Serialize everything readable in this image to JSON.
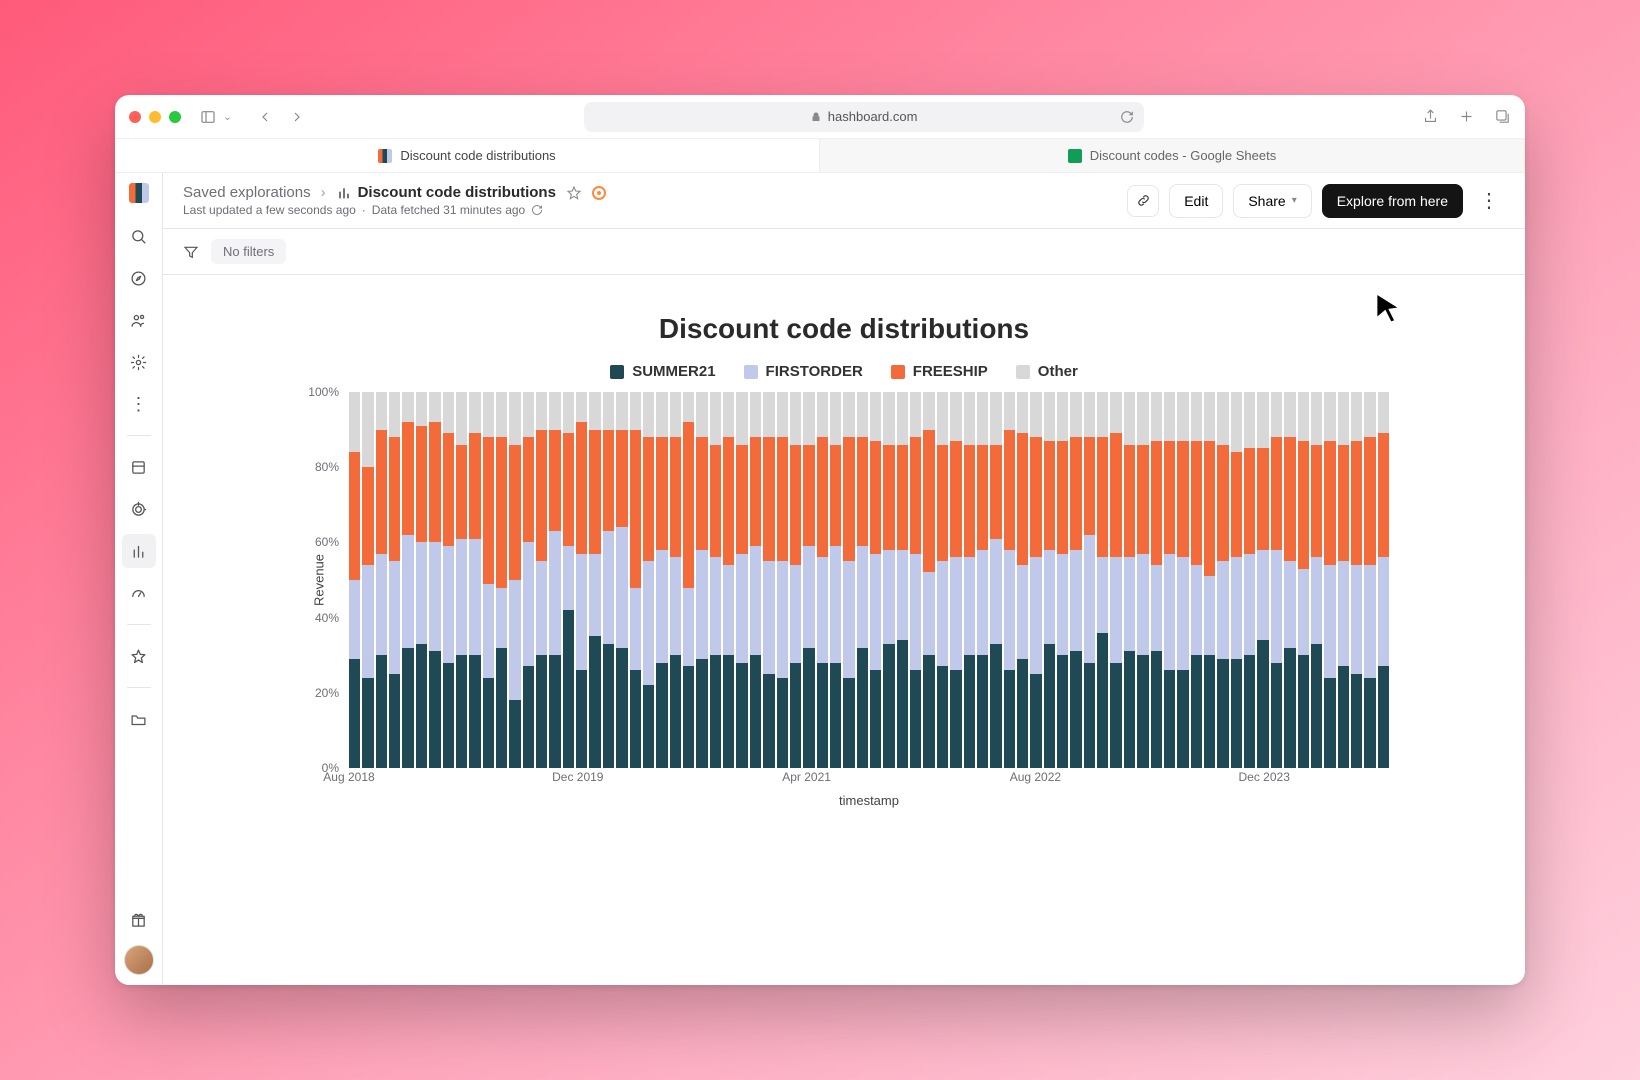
{
  "browser": {
    "url": "hashboard.com",
    "tabs": [
      {
        "label": "Discount code distributions"
      },
      {
        "label": "Discount codes - Google Sheets"
      }
    ]
  },
  "header": {
    "breadcrumb_root": "Saved explorations",
    "title": "Discount code distributions",
    "meta_updated": "Last updated a few seconds ago",
    "meta_fetched": "Data fetched 31 minutes ago",
    "edit": "Edit",
    "share": "Share",
    "explore": "Explore from here"
  },
  "filters": {
    "label": "No filters"
  },
  "chart": {
    "title": "Discount code distributions",
    "legend": [
      "SUMMER21",
      "FIRSTORDER",
      "FREESHIP",
      "Other"
    ],
    "xlabel": "timestamp",
    "ylabel": "Revenue"
  },
  "chart_data": {
    "type": "bar",
    "stacked": true,
    "normalized_percent": true,
    "title": "Discount code distributions",
    "xlabel": "timestamp",
    "ylabel": "Revenue",
    "ylim": [
      0,
      100
    ],
    "y_ticks": [
      0,
      20,
      40,
      60,
      80,
      100
    ],
    "x_ticks": [
      {
        "pos": 0.0,
        "label": "Aug 2018"
      },
      {
        "pos": 0.22,
        "label": "Dec 2019"
      },
      {
        "pos": 0.44,
        "label": "Apr 2021"
      },
      {
        "pos": 0.66,
        "label": "Aug 2022"
      },
      {
        "pos": 0.88,
        "label": "Dec 2023"
      }
    ],
    "series_names": [
      "SUMMER21",
      "FIRSTORDER",
      "FREESHIP",
      "Other"
    ],
    "series_colors": {
      "SUMMER21": "#1f4a55",
      "FIRSTORDER": "#c0c9ea",
      "FREESHIP": "#f36b3b",
      "Other": "#d8d8d8"
    },
    "columns": [
      {
        "SUMMER21": 29,
        "FIRSTORDER": 21,
        "FREESHIP": 34,
        "Other": 16
      },
      {
        "SUMMER21": 24,
        "FIRSTORDER": 30,
        "FREESHIP": 26,
        "Other": 20
      },
      {
        "SUMMER21": 30,
        "FIRSTORDER": 27,
        "FREESHIP": 33,
        "Other": 10
      },
      {
        "SUMMER21": 25,
        "FIRSTORDER": 30,
        "FREESHIP": 33,
        "Other": 12
      },
      {
        "SUMMER21": 32,
        "FIRSTORDER": 30,
        "FREESHIP": 30,
        "Other": 8
      },
      {
        "SUMMER21": 33,
        "FIRSTORDER": 27,
        "FREESHIP": 31,
        "Other": 9
      },
      {
        "SUMMER21": 31,
        "FIRSTORDER": 29,
        "FREESHIP": 32,
        "Other": 8
      },
      {
        "SUMMER21": 28,
        "FIRSTORDER": 31,
        "FREESHIP": 30,
        "Other": 11
      },
      {
        "SUMMER21": 30,
        "FIRSTORDER": 31,
        "FREESHIP": 25,
        "Other": 14
      },
      {
        "SUMMER21": 30,
        "FIRSTORDER": 31,
        "FREESHIP": 28,
        "Other": 11
      },
      {
        "SUMMER21": 24,
        "FIRSTORDER": 25,
        "FREESHIP": 39,
        "Other": 12
      },
      {
        "SUMMER21": 32,
        "FIRSTORDER": 16,
        "FREESHIP": 40,
        "Other": 12
      },
      {
        "SUMMER21": 18,
        "FIRSTORDER": 32,
        "FREESHIP": 36,
        "Other": 14
      },
      {
        "SUMMER21": 27,
        "FIRSTORDER": 33,
        "FREESHIP": 28,
        "Other": 12
      },
      {
        "SUMMER21": 30,
        "FIRSTORDER": 25,
        "FREESHIP": 35,
        "Other": 10
      },
      {
        "SUMMER21": 30,
        "FIRSTORDER": 33,
        "FREESHIP": 27,
        "Other": 10
      },
      {
        "SUMMER21": 42,
        "FIRSTORDER": 17,
        "FREESHIP": 30,
        "Other": 11
      },
      {
        "SUMMER21": 26,
        "FIRSTORDER": 31,
        "FREESHIP": 35,
        "Other": 8
      },
      {
        "SUMMER21": 35,
        "FIRSTORDER": 22,
        "FREESHIP": 33,
        "Other": 10
      },
      {
        "SUMMER21": 33,
        "FIRSTORDER": 30,
        "FREESHIP": 27,
        "Other": 10
      },
      {
        "SUMMER21": 32,
        "FIRSTORDER": 32,
        "FREESHIP": 26,
        "Other": 10
      },
      {
        "SUMMER21": 26,
        "FIRSTORDER": 22,
        "FREESHIP": 42,
        "Other": 10
      },
      {
        "SUMMER21": 22,
        "FIRSTORDER": 33,
        "FREESHIP": 33,
        "Other": 12
      },
      {
        "SUMMER21": 28,
        "FIRSTORDER": 30,
        "FREESHIP": 30,
        "Other": 12
      },
      {
        "SUMMER21": 30,
        "FIRSTORDER": 26,
        "FREESHIP": 32,
        "Other": 12
      },
      {
        "SUMMER21": 27,
        "FIRSTORDER": 21,
        "FREESHIP": 44,
        "Other": 8
      },
      {
        "SUMMER21": 29,
        "FIRSTORDER": 29,
        "FREESHIP": 30,
        "Other": 12
      },
      {
        "SUMMER21": 30,
        "FIRSTORDER": 26,
        "FREESHIP": 30,
        "Other": 14
      },
      {
        "SUMMER21": 30,
        "FIRSTORDER": 24,
        "FREESHIP": 34,
        "Other": 12
      },
      {
        "SUMMER21": 28,
        "FIRSTORDER": 29,
        "FREESHIP": 29,
        "Other": 14
      },
      {
        "SUMMER21": 30,
        "FIRSTORDER": 29,
        "FREESHIP": 29,
        "Other": 12
      },
      {
        "SUMMER21": 25,
        "FIRSTORDER": 30,
        "FREESHIP": 33,
        "Other": 12
      },
      {
        "SUMMER21": 24,
        "FIRSTORDER": 31,
        "FREESHIP": 33,
        "Other": 12
      },
      {
        "SUMMER21": 28,
        "FIRSTORDER": 26,
        "FREESHIP": 32,
        "Other": 14
      },
      {
        "SUMMER21": 32,
        "FIRSTORDER": 27,
        "FREESHIP": 27,
        "Other": 14
      },
      {
        "SUMMER21": 28,
        "FIRSTORDER": 28,
        "FREESHIP": 32,
        "Other": 12
      },
      {
        "SUMMER21": 28,
        "FIRSTORDER": 31,
        "FREESHIP": 27,
        "Other": 14
      },
      {
        "SUMMER21": 24,
        "FIRSTORDER": 31,
        "FREESHIP": 33,
        "Other": 12
      },
      {
        "SUMMER21": 32,
        "FIRSTORDER": 27,
        "FREESHIP": 29,
        "Other": 12
      },
      {
        "SUMMER21": 26,
        "FIRSTORDER": 31,
        "FREESHIP": 30,
        "Other": 13
      },
      {
        "SUMMER21": 33,
        "FIRSTORDER": 25,
        "FREESHIP": 28,
        "Other": 14
      },
      {
        "SUMMER21": 34,
        "FIRSTORDER": 24,
        "FREESHIP": 28,
        "Other": 14
      },
      {
        "SUMMER21": 26,
        "FIRSTORDER": 31,
        "FREESHIP": 31,
        "Other": 12
      },
      {
        "SUMMER21": 30,
        "FIRSTORDER": 22,
        "FREESHIP": 38,
        "Other": 10
      },
      {
        "SUMMER21": 27,
        "FIRSTORDER": 28,
        "FREESHIP": 31,
        "Other": 14
      },
      {
        "SUMMER21": 26,
        "FIRSTORDER": 30,
        "FREESHIP": 31,
        "Other": 13
      },
      {
        "SUMMER21": 30,
        "FIRSTORDER": 26,
        "FREESHIP": 30,
        "Other": 14
      },
      {
        "SUMMER21": 30,
        "FIRSTORDER": 28,
        "FREESHIP": 28,
        "Other": 14
      },
      {
        "SUMMER21": 33,
        "FIRSTORDER": 28,
        "FREESHIP": 25,
        "Other": 14
      },
      {
        "SUMMER21": 26,
        "FIRSTORDER": 32,
        "FREESHIP": 32,
        "Other": 10
      },
      {
        "SUMMER21": 29,
        "FIRSTORDER": 25,
        "FREESHIP": 35,
        "Other": 11
      },
      {
        "SUMMER21": 25,
        "FIRSTORDER": 31,
        "FREESHIP": 32,
        "Other": 12
      },
      {
        "SUMMER21": 33,
        "FIRSTORDER": 25,
        "FREESHIP": 29,
        "Other": 13
      },
      {
        "SUMMER21": 30,
        "FIRSTORDER": 27,
        "FREESHIP": 30,
        "Other": 13
      },
      {
        "SUMMER21": 31,
        "FIRSTORDER": 27,
        "FREESHIP": 30,
        "Other": 12
      },
      {
        "SUMMER21": 28,
        "FIRSTORDER": 34,
        "FREESHIP": 26,
        "Other": 12
      },
      {
        "SUMMER21": 36,
        "FIRSTORDER": 20,
        "FREESHIP": 32,
        "Other": 12
      },
      {
        "SUMMER21": 28,
        "FIRSTORDER": 28,
        "FREESHIP": 33,
        "Other": 11
      },
      {
        "SUMMER21": 31,
        "FIRSTORDER": 25,
        "FREESHIP": 30,
        "Other": 14
      },
      {
        "SUMMER21": 30,
        "FIRSTORDER": 27,
        "FREESHIP": 29,
        "Other": 14
      },
      {
        "SUMMER21": 31,
        "FIRSTORDER": 23,
        "FREESHIP": 33,
        "Other": 13
      },
      {
        "SUMMER21": 26,
        "FIRSTORDER": 31,
        "FREESHIP": 30,
        "Other": 13
      },
      {
        "SUMMER21": 26,
        "FIRSTORDER": 30,
        "FREESHIP": 31,
        "Other": 13
      },
      {
        "SUMMER21": 30,
        "FIRSTORDER": 24,
        "FREESHIP": 33,
        "Other": 13
      },
      {
        "SUMMER21": 30,
        "FIRSTORDER": 21,
        "FREESHIP": 36,
        "Other": 13
      },
      {
        "SUMMER21": 29,
        "FIRSTORDER": 26,
        "FREESHIP": 31,
        "Other": 14
      },
      {
        "SUMMER21": 29,
        "FIRSTORDER": 27,
        "FREESHIP": 28,
        "Other": 16
      },
      {
        "SUMMER21": 30,
        "FIRSTORDER": 27,
        "FREESHIP": 28,
        "Other": 15
      },
      {
        "SUMMER21": 34,
        "FIRSTORDER": 24,
        "FREESHIP": 27,
        "Other": 15
      },
      {
        "SUMMER21": 28,
        "FIRSTORDER": 30,
        "FREESHIP": 30,
        "Other": 12
      },
      {
        "SUMMER21": 32,
        "FIRSTORDER": 23,
        "FREESHIP": 33,
        "Other": 12
      },
      {
        "SUMMER21": 30,
        "FIRSTORDER": 23,
        "FREESHIP": 34,
        "Other": 13
      },
      {
        "SUMMER21": 33,
        "FIRSTORDER": 23,
        "FREESHIP": 30,
        "Other": 14
      },
      {
        "SUMMER21": 24,
        "FIRSTORDER": 30,
        "FREESHIP": 33,
        "Other": 13
      },
      {
        "SUMMER21": 27,
        "FIRSTORDER": 28,
        "FREESHIP": 31,
        "Other": 14
      },
      {
        "SUMMER21": 25,
        "FIRSTORDER": 29,
        "FREESHIP": 33,
        "Other": 13
      },
      {
        "SUMMER21": 24,
        "FIRSTORDER": 30,
        "FREESHIP": 34,
        "Other": 12
      },
      {
        "SUMMER21": 27,
        "FIRSTORDER": 29,
        "FREESHIP": 33,
        "Other": 11
      }
    ]
  }
}
